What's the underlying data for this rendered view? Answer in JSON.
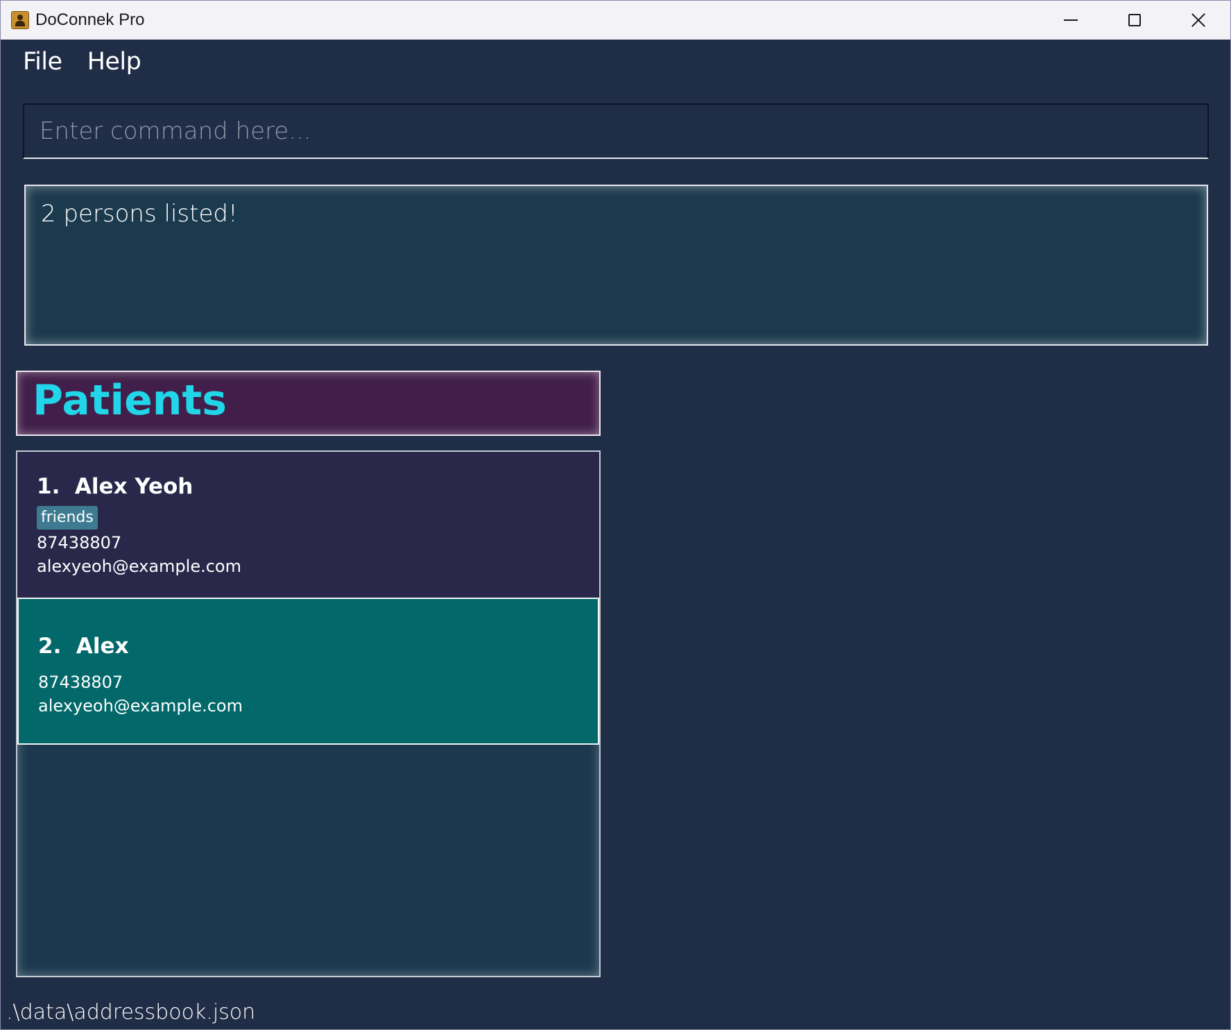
{
  "window": {
    "title": "DoConnek Pro"
  },
  "menu": {
    "items": [
      {
        "label": "File"
      },
      {
        "label": "Help"
      }
    ]
  },
  "command": {
    "placeholder": "Enter command here...",
    "value": ""
  },
  "result": {
    "message": "2 persons listed!"
  },
  "patients_panel": {
    "title": "Patients",
    "persons": [
      {
        "name": "1.  Alex Yeoh",
        "tags": [
          "friends"
        ],
        "phone": "87438807",
        "email": "alexyeoh@example.com"
      },
      {
        "name": "2.  Alex",
        "tags": [],
        "phone": "87438807",
        "email": "alexyeoh@example.com"
      }
    ]
  },
  "status_bar": {
    "file_path": ".\\data\\addressbook.json"
  },
  "colors": {
    "background": "#202d47",
    "accent_title": "#21d6e8",
    "header_bg": "#421f4a",
    "selected_card": "#02686a",
    "tag_bg": "#3e7b91"
  }
}
